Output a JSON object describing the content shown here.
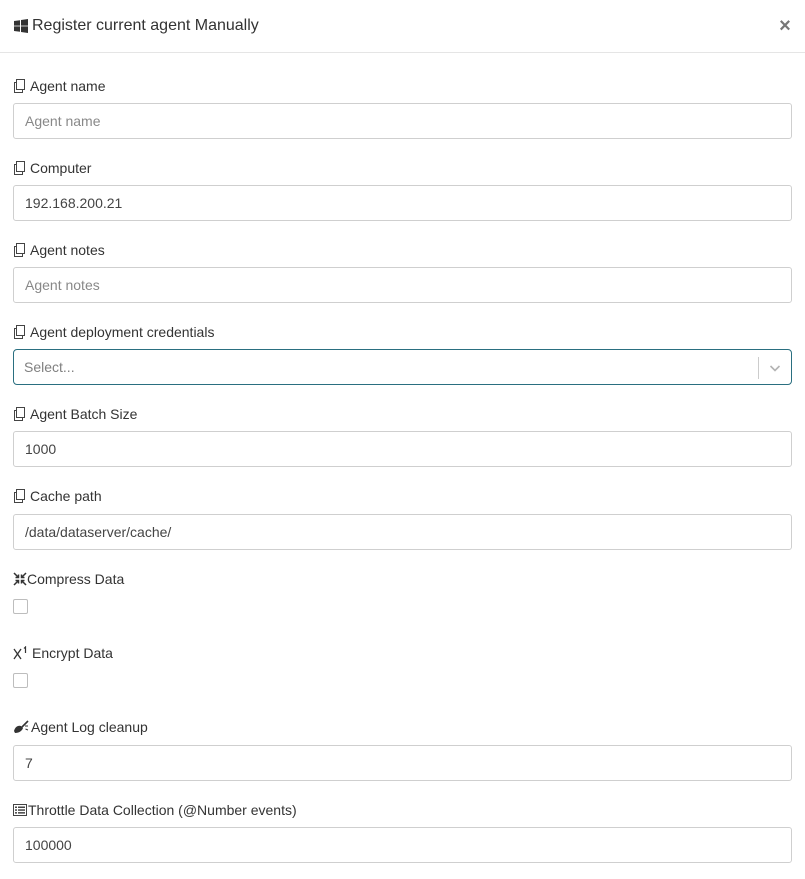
{
  "dialog": {
    "title": "Register current agent Manually",
    "title_icon": "windows-icon",
    "close_label": "×"
  },
  "fields": {
    "agent_name": {
      "label": "Agent name",
      "icon": "copy-icon",
      "value": "",
      "placeholder": "Agent name"
    },
    "computer": {
      "label": "Computer",
      "icon": "copy-icon",
      "value": "192.168.200.21",
      "placeholder": ""
    },
    "agent_notes": {
      "label": "Agent notes",
      "icon": "copy-icon",
      "value": "",
      "placeholder": "Agent notes"
    },
    "credentials": {
      "label": "Agent deployment credentials",
      "icon": "copy-icon",
      "selected": "Select..."
    },
    "batch_size": {
      "label": "Agent Batch Size",
      "icon": "copy-icon",
      "value": "1000",
      "placeholder": ""
    },
    "cache_path": {
      "label": "Cache path",
      "icon": "copy-icon",
      "value": "/data/dataserver/cache/",
      "placeholder": ""
    },
    "compress": {
      "label": "Compress Data",
      "icon": "compress-icon",
      "checked": false
    },
    "encrypt": {
      "label": "Encrypt Data",
      "icon": "superscript-icon",
      "checked": false
    },
    "log_cleanup": {
      "label": "Agent Log cleanup",
      "icon": "eraser-icon",
      "value": "7",
      "placeholder": ""
    },
    "throttle": {
      "label": "Throttle Data Collection (@Number events)",
      "icon": "list-alt-icon",
      "value": "100000",
      "placeholder": ""
    }
  },
  "colors": {
    "select_focus_border": "#2a6f80",
    "input_border": "#cfcfcf",
    "text": "#333333"
  }
}
